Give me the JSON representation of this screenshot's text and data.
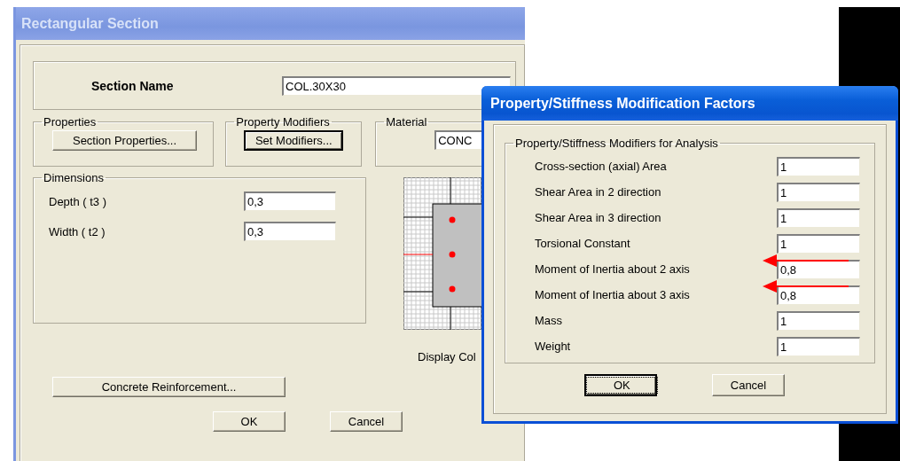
{
  "section_dialog": {
    "title": "Rectangular Section",
    "active": false,
    "section_name": {
      "label": "Section Name",
      "value": "COL.30X30"
    },
    "properties_group": {
      "legend": "Properties",
      "button": {
        "label": "Section Properties...",
        "default": false
      }
    },
    "modifiers_group": {
      "legend": "Property Modifiers",
      "button": {
        "label": "Set Modifiers...",
        "default": true
      }
    },
    "material_group": {
      "legend": "Material",
      "value": "CONC"
    },
    "dimensions": {
      "legend": "Dimensions",
      "fields": [
        {
          "label": "Depth  ( t3 )",
          "value": "0,3"
        },
        {
          "label": "Width  ( t2 )",
          "value": "0,3"
        }
      ]
    },
    "preview_caption": "Display Col",
    "reinforcement_button": "Concrete Reinforcement...",
    "buttons": [
      {
        "label": "OK",
        "default": false
      },
      {
        "label": "Cancel",
        "default": false
      }
    ]
  },
  "modifiers_dialog": {
    "title": "Property/Stiffness Modification Factors",
    "active": true,
    "group_legend": "Property/Stiffness Modifiers for Analysis",
    "rows": [
      {
        "label": "Cross-section (axial) Area",
        "value": "1",
        "marked": false
      },
      {
        "label": "Shear Area in 2 direction",
        "value": "1",
        "marked": false
      },
      {
        "label": "Shear Area in 3 direction",
        "value": "1",
        "marked": false
      },
      {
        "label": "Torsional Constant",
        "value": "1",
        "marked": false
      },
      {
        "label": "Moment of Inertia about 2 axis",
        "value": "0,8",
        "marked": true
      },
      {
        "label": "Moment of Inertia about 3 axis",
        "value": "0,8",
        "marked": true
      },
      {
        "label": "Mass",
        "value": "1",
        "marked": false
      },
      {
        "label": "Weight",
        "value": "1",
        "marked": false
      }
    ],
    "buttons": [
      {
        "label": "OK",
        "default": true
      },
      {
        "label": "Cancel",
        "default": false
      }
    ]
  }
}
